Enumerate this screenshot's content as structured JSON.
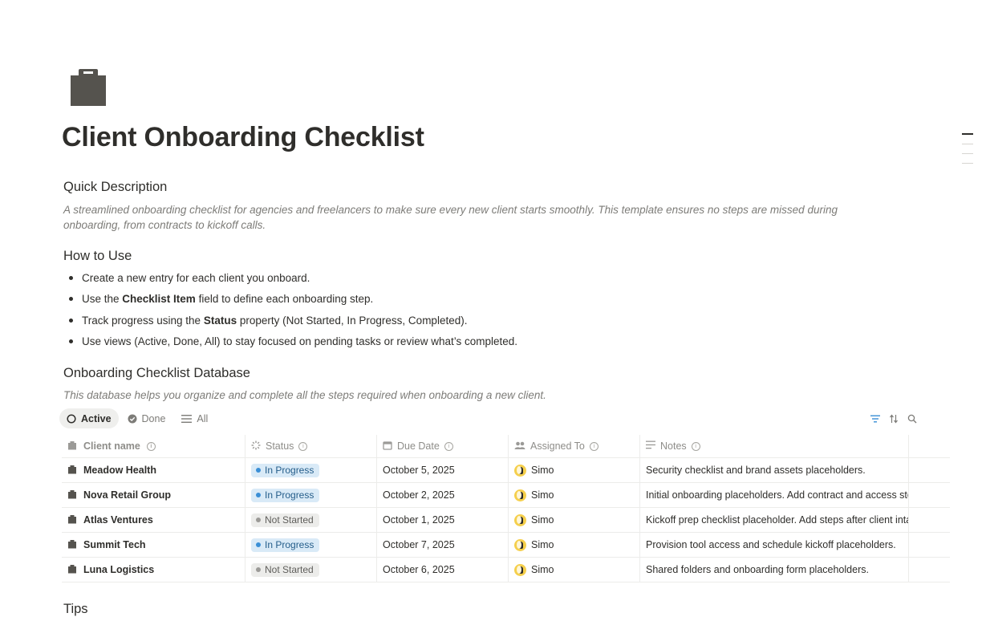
{
  "page": {
    "title": "Client Onboarding Checklist",
    "icon": "clipboard-icon"
  },
  "quick": {
    "heading": "Quick Description",
    "text": "A streamlined onboarding checklist for agencies and freelancers to make sure every new client starts smoothly. This template ensures no steps are missed during onboarding, from contracts to kickoff calls."
  },
  "how": {
    "heading": "How to Use",
    "items": [
      {
        "pre": "Create a new entry for each client you onboard.",
        "bold": "",
        "post": ""
      },
      {
        "pre": "Use the ",
        "bold": "Checklist Item",
        "post": " field to define each onboarding step."
      },
      {
        "pre": "Track progress using the ",
        "bold": "Status",
        "post": " property (Not Started, In Progress, Completed)."
      },
      {
        "pre": "Use views (Active, Done, All) to stay focused on pending tasks or review what’s completed.",
        "bold": "",
        "post": ""
      }
    ]
  },
  "database": {
    "heading": "Onboarding Checklist Database",
    "description": "This database helps you organize and complete all the steps required when onboarding a new client.",
    "views": [
      {
        "label": "Active",
        "icon": "circle-icon",
        "active": true
      },
      {
        "label": "Done",
        "icon": "check-circle-icon",
        "active": false
      },
      {
        "label": "All",
        "icon": "list-icon",
        "active": false
      }
    ],
    "columns": [
      "Client name",
      "Status",
      "Due Date",
      "Assigned To",
      "Notes"
    ],
    "rows": [
      {
        "client": "Meadow Health",
        "status": "In Progress",
        "due": "October 5, 2025",
        "assignee": "Simo",
        "notes": "Security checklist and brand assets placeholders."
      },
      {
        "client": "Nova Retail Group",
        "status": "In Progress",
        "due": "October 2, 2025",
        "assignee": "Simo",
        "notes": "Initial onboarding placeholders. Add contract and access steps."
      },
      {
        "client": "Atlas Ventures",
        "status": "Not Started",
        "due": "October 1, 2025",
        "assignee": "Simo",
        "notes": "Kickoff prep checklist placeholder. Add steps after client intake."
      },
      {
        "client": "Summit Tech",
        "status": "In Progress",
        "due": "October 7, 2025",
        "assignee": "Simo",
        "notes": "Provision tool access and schedule kickoff placeholders."
      },
      {
        "client": "Luna Logistics",
        "status": "Not Started",
        "due": "October 6, 2025",
        "assignee": "Simo",
        "notes": "Shared folders and onboarding form placeholders."
      }
    ],
    "status_colors": {
      "In Progress": "#3a8fd6",
      "Not Started": "#9b9a97"
    }
  },
  "tips": {
    "heading": "Tips"
  },
  "colors": {
    "text": "#2f2e2b",
    "muted": "#7d7c78",
    "accent": "#3a8fd6"
  }
}
